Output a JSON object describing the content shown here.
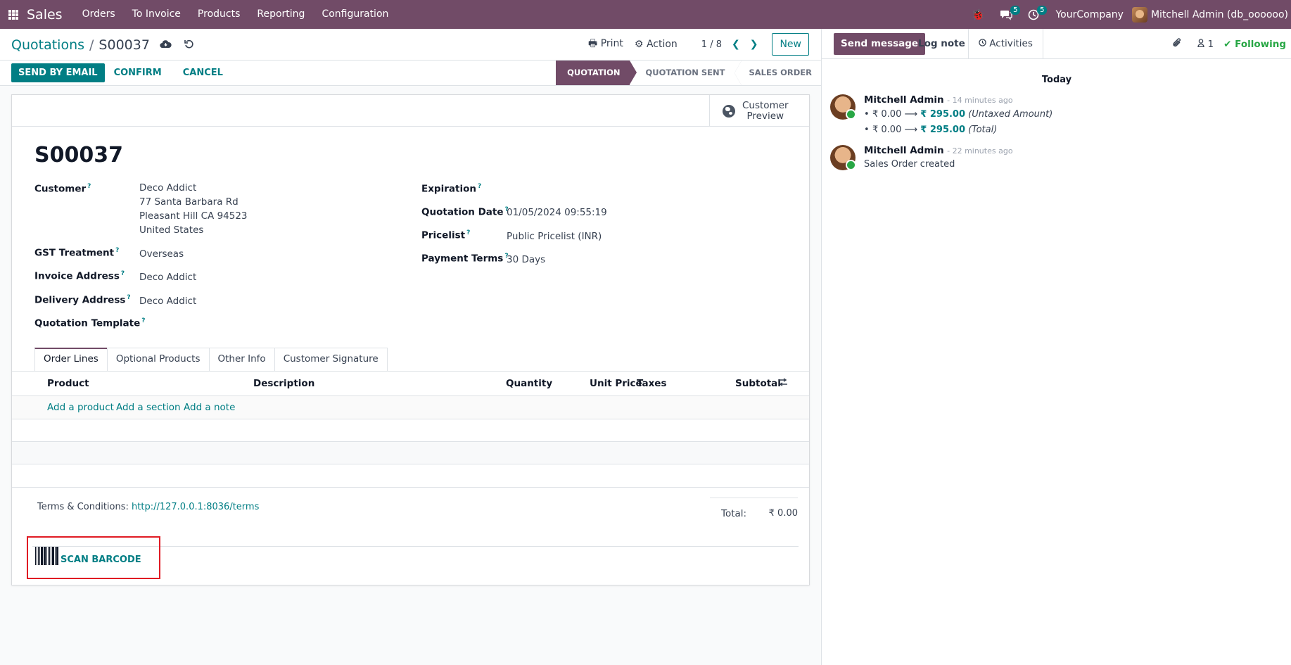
{
  "navbar": {
    "app_name": "Sales",
    "menu": [
      "Orders",
      "To Invoice",
      "Products",
      "Reporting",
      "Configuration"
    ],
    "messages_count": "5",
    "activities_count": "5",
    "company": "YourCompany",
    "user": "Mitchell Admin (db_oooooo)"
  },
  "control": {
    "breadcrumb_parent": "Quotations",
    "breadcrumb_sep": "/",
    "breadcrumb_current": "S00037",
    "print": "Print",
    "action": "Action",
    "pager": "1 / 8",
    "new": "New"
  },
  "statusbar": {
    "send_email": "SEND BY EMAIL",
    "confirm": "CONFIRM",
    "cancel": "CANCEL",
    "stages": [
      "QUOTATION",
      "QUOTATION SENT",
      "SALES ORDER"
    ]
  },
  "form": {
    "preview_line1": "Customer",
    "preview_line2": "Preview",
    "title": "S00037",
    "customer_label": "Customer",
    "customer_name": "Deco Addict",
    "customer_addr1": "77 Santa Barbara Rd",
    "customer_addr2": "Pleasant Hill CA 94523",
    "customer_addr3": "United States",
    "gst_label": "GST Treatment",
    "gst_value": "Overseas",
    "invoice_label": "Invoice Address",
    "invoice_value": "Deco Addict",
    "delivery_label": "Delivery Address",
    "delivery_value": "Deco Addict",
    "template_label": "Quotation Template",
    "expiration_label": "Expiration",
    "date_label": "Quotation Date",
    "date_value": "01/05/2024 09:55:19",
    "pricelist_label": "Pricelist",
    "pricelist_value": "Public Pricelist (INR)",
    "terms_label": "Payment Terms",
    "terms_value": "30 Days",
    "help_mark": "?"
  },
  "tabs": [
    "Order Lines",
    "Optional Products",
    "Other Info",
    "Customer Signature"
  ],
  "table": {
    "columns": [
      "Product",
      "Description",
      "Quantity",
      "Unit Price",
      "Taxes",
      "Subtotal"
    ],
    "add_product": "Add a product",
    "add_section": "Add a section",
    "add_note": "Add a note"
  },
  "footer": {
    "terms_prefix": "Terms & Conditions:",
    "terms_url": "http://127.0.0.1:8036/terms",
    "total_label": "Total:",
    "total_value": "₹ 0.00",
    "scan_barcode": "SCAN BARCODE"
  },
  "chatter": {
    "send_message": "Send message",
    "log_note": "Log note",
    "activities": "Activities",
    "followers": "1",
    "following": "Following",
    "today": "Today",
    "messages": [
      {
        "author": "Mitchell Admin",
        "time": "- 14 minutes ago",
        "changes": [
          {
            "old": "₹ 0.00",
            "new": "₹ 295.00",
            "field": "(Untaxed Amount)"
          },
          {
            "old": "₹ 0.00",
            "new": "₹ 295.00",
            "field": "(Total)"
          }
        ]
      },
      {
        "author": "Mitchell Admin",
        "time": "- 22 minutes ago",
        "body": "Sales Order created"
      }
    ]
  },
  "colors": {
    "brand": "#714b67",
    "accent": "#017e84",
    "highlight": "#e01b24",
    "following": "#28a745"
  }
}
